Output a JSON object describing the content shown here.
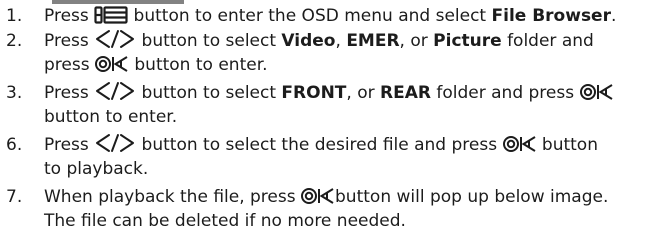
{
  "steps": [
    {
      "number": "1.",
      "lines": [
        [
          "Press ",
          "{menu}",
          " button to enter the OSD menu and select ",
          "**File Browser",
          "."
        ]
      ]
    },
    {
      "number": "2.",
      "lines": [
        [
          "Press ",
          "{arrows}",
          " button to select ",
          "**Video",
          ", ",
          "**EMER",
          ", or ",
          "**Picture",
          " folder and"
        ],
        [
          "press ",
          "{ok}",
          " button to enter."
        ]
      ]
    },
    {
      "number": "3.",
      "lines": [
        [
          "Press ",
          "{arrows}",
          " button to select ",
          "**FRONT",
          ", or ",
          "**REAR",
          " folder and press ",
          "{ok}"
        ],
        [
          "button to enter."
        ]
      ]
    },
    {
      "number": "6.",
      "lines": [
        [
          "Press ",
          "{arrows}",
          " button to select the desired file and press ",
          "{ok}",
          " button"
        ],
        [
          "to playback."
        ]
      ]
    },
    {
      "number": "7.",
      "lines": [
        [
          "When playback the file, press ",
          "{ok}",
          "button will pop up below image."
        ],
        [
          "The file can be deleted if no more needed."
        ]
      ]
    }
  ],
  "icons": {
    "menu": "menu-icon",
    "arrows": "left-right-arrows-icon",
    "ok": "ok-icon"
  },
  "colors": {
    "text": "#1c1c1c"
  }
}
